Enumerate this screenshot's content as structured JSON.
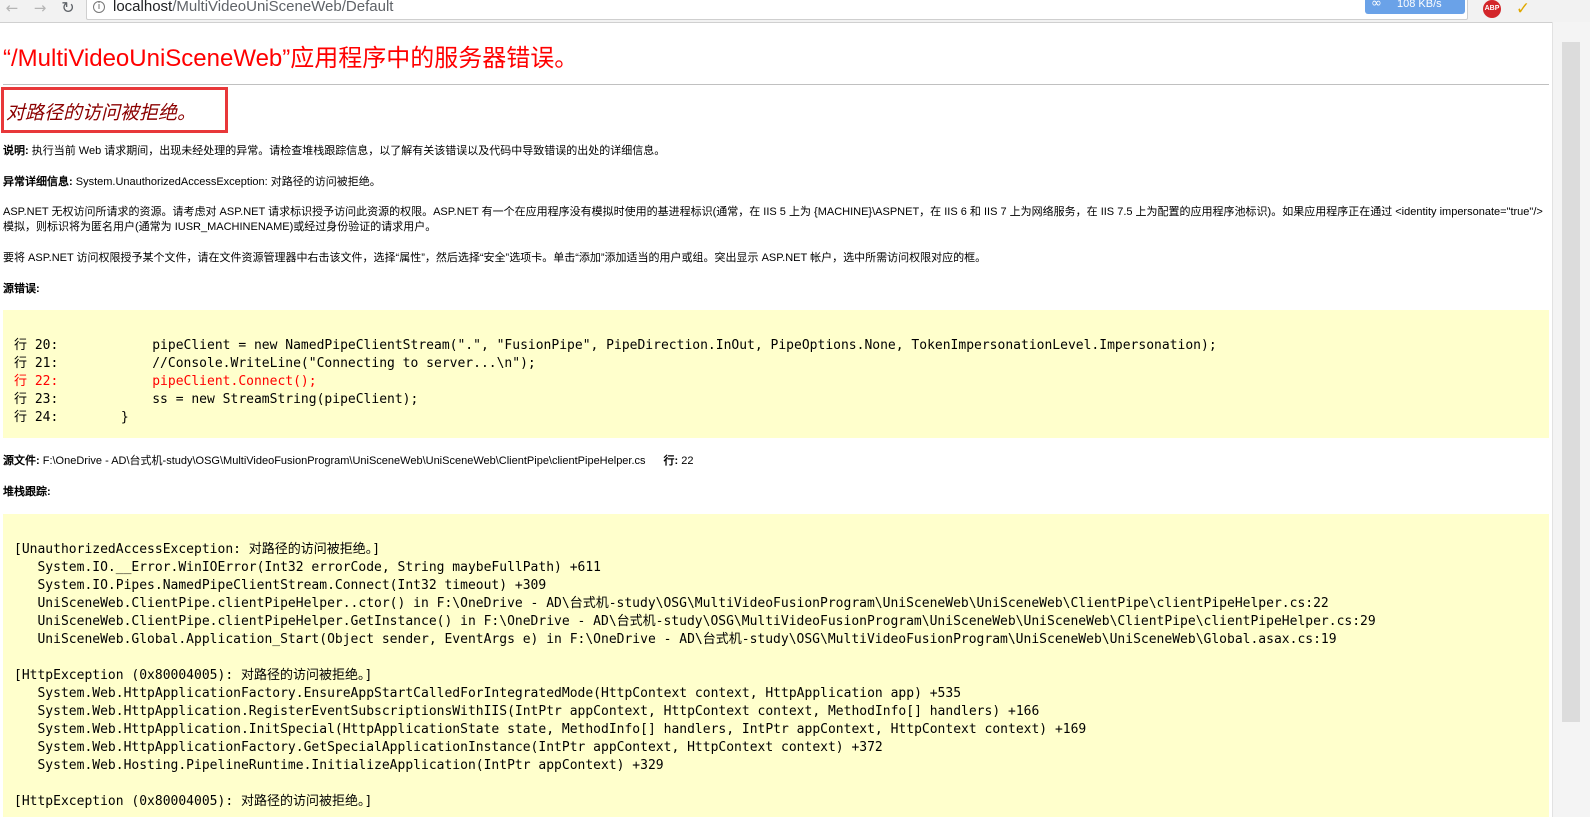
{
  "browser": {
    "url_host": "localhost",
    "url_path": "/MultiVideoUniSceneWeb/Default",
    "speed_indicator": "108 KB/s",
    "adblock_label": "ABP"
  },
  "error_page": {
    "title": "“/MultiVideoUniSceneWeb”应用程序中的服务器错误。",
    "subtitle": "对路径的访问被拒绝。",
    "description_label": "说明:",
    "description_text": " 执行当前 Web 请求期间，出现未经处理的异常。请检查堆栈跟踪信息，以了解有关该错误以及代码中导致错误的出处的详细信息。",
    "exception_label": "异常详细信息:",
    "exception_text": " System.UnauthorizedAccessException: 对路径的访问被拒绝。",
    "aspnet_para": "ASP.NET 无权访问所请求的资源。请考虑对 ASP.NET 请求标识授予访问此资源的权限。ASP.NET 有一个在应用程序没有模拟时使用的基进程标识(通常，在 IIS 5 上为 {MACHINE}\\ASPNET，在 IIS 6 和 IIS 7 上为网络服务，在 IIS 7.5 上为配置的应用程序池标识)。如果应用程序正在通过 <identity impersonate=\"true\"/> 模拟，则标识将为匿名用户(通常为 IUSR_MACHINENAME)或经过身份验证的请求用户。",
    "grant_para": "要将 ASP.NET 访问权限授予某个文件，请在文件资源管理器中右击该文件，选择“属性”，然后选择“安全”选项卡。单击“添加”添加适当的用户或组。突出显示 ASP.NET 帐户，选中所需访问权限对应的框。",
    "source_error_label": "源错误:",
    "source_lines": [
      {
        "text": "行 20:            pipeClient = new NamedPipeClientStream(\".\", \"FusionPipe\", PipeDirection.InOut, PipeOptions.None, TokenImpersonationLevel.Impersonation);",
        "highlight": false
      },
      {
        "text": "行 21:            //Console.WriteLine(\"Connecting to server...\\n\");",
        "highlight": false
      },
      {
        "text": "行 22:            pipeClient.Connect();",
        "highlight": true
      },
      {
        "text": "行 23:            ss = new StreamString(pipeClient);",
        "highlight": false
      },
      {
        "text": "行 24:        }",
        "highlight": false
      }
    ],
    "source_file_label": "源文件:",
    "source_file_path": " F:\\OneDrive - AD\\台式机-study\\OSG\\MultiVideoFusionProgram\\UniSceneWeb\\UniSceneWeb\\ClientPipe\\clientPipeHelper.cs",
    "line_label": "行:",
    "line_value": " 22",
    "stack_trace_label": "堆栈跟踪:",
    "stack_lines": [
      "[UnauthorizedAccessException: 对路径的访问被拒绝。]",
      "   System.IO.__Error.WinIOError(Int32 errorCode, String maybeFullPath) +611",
      "   System.IO.Pipes.NamedPipeClientStream.Connect(Int32 timeout) +309",
      "   UniSceneWeb.ClientPipe.clientPipeHelper..ctor() in F:\\OneDrive - AD\\台式机-study\\OSG\\MultiVideoFusionProgram\\UniSceneWeb\\UniSceneWeb\\ClientPipe\\clientPipeHelper.cs:22",
      "   UniSceneWeb.ClientPipe.clientPipeHelper.GetInstance() in F:\\OneDrive - AD\\台式机-study\\OSG\\MultiVideoFusionProgram\\UniSceneWeb\\UniSceneWeb\\ClientPipe\\clientPipeHelper.cs:29",
      "   UniSceneWeb.Global.Application_Start(Object sender, EventArgs e) in F:\\OneDrive - AD\\台式机-study\\OSG\\MultiVideoFusionProgram\\UniSceneWeb\\UniSceneWeb\\Global.asax.cs:19",
      "",
      "[HttpException (0x80004005): 对路径的访问被拒绝。]",
      "   System.Web.HttpApplicationFactory.EnsureAppStartCalledForIntegratedMode(HttpContext context, HttpApplication app) +535",
      "   System.Web.HttpApplication.RegisterEventSubscriptionsWithIIS(IntPtr appContext, HttpContext context, MethodInfo[] handlers) +166",
      "   System.Web.HttpApplication.InitSpecial(HttpApplicationState state, MethodInfo[] handlers, IntPtr appContext, HttpContext context) +169",
      "   System.Web.HttpApplicationFactory.GetSpecialApplicationInstance(IntPtr appContext, HttpContext context) +372",
      "   System.Web.Hosting.PipelineRuntime.InitializeApplication(IntPtr appContext) +329",
      "",
      "[HttpException (0x80004005): 对路径的访问被拒绝。]"
    ]
  }
}
